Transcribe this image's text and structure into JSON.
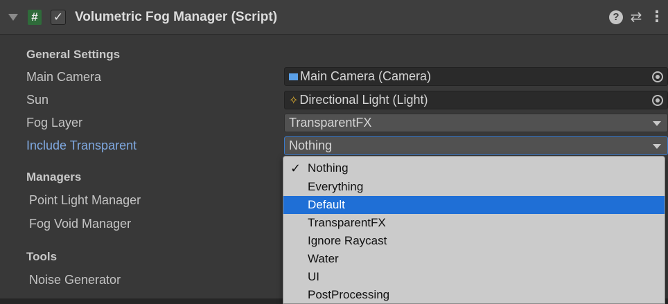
{
  "header": {
    "script_icon": "#",
    "enabled_check": "✓",
    "title": "Volumetric Fog Manager (Script)",
    "help_icon": "?",
    "presets_icon": "⇄",
    "menu_icon": "⋮"
  },
  "sections": {
    "general": "General Settings",
    "managers": "Managers",
    "tools": "Tools"
  },
  "fields": {
    "main_camera": {
      "label": "Main Camera",
      "value": "Main Camera (Camera)"
    },
    "sun": {
      "label": "Sun",
      "value": "Directional Light (Light)"
    },
    "fog_layer": {
      "label": "Fog Layer",
      "value": "TransparentFX"
    },
    "include_transparent": {
      "label": "Include Transparent",
      "value": "Nothing"
    }
  },
  "managers": {
    "point_light": "Point Light Manager",
    "fog_void": "Fog Void Manager"
  },
  "tools": {
    "noise_generator": "Noise Generator"
  },
  "dropdown": {
    "check_mark": "✓",
    "selected_index": 2,
    "items": [
      "Nothing",
      "Everything",
      "Default",
      "TransparentFX",
      "Ignore Raycast",
      "Water",
      "UI",
      "PostProcessing"
    ]
  },
  "colors": {
    "background": "#383838",
    "highlight": "#1f6fd6",
    "active_label": "#7fa8e0"
  }
}
